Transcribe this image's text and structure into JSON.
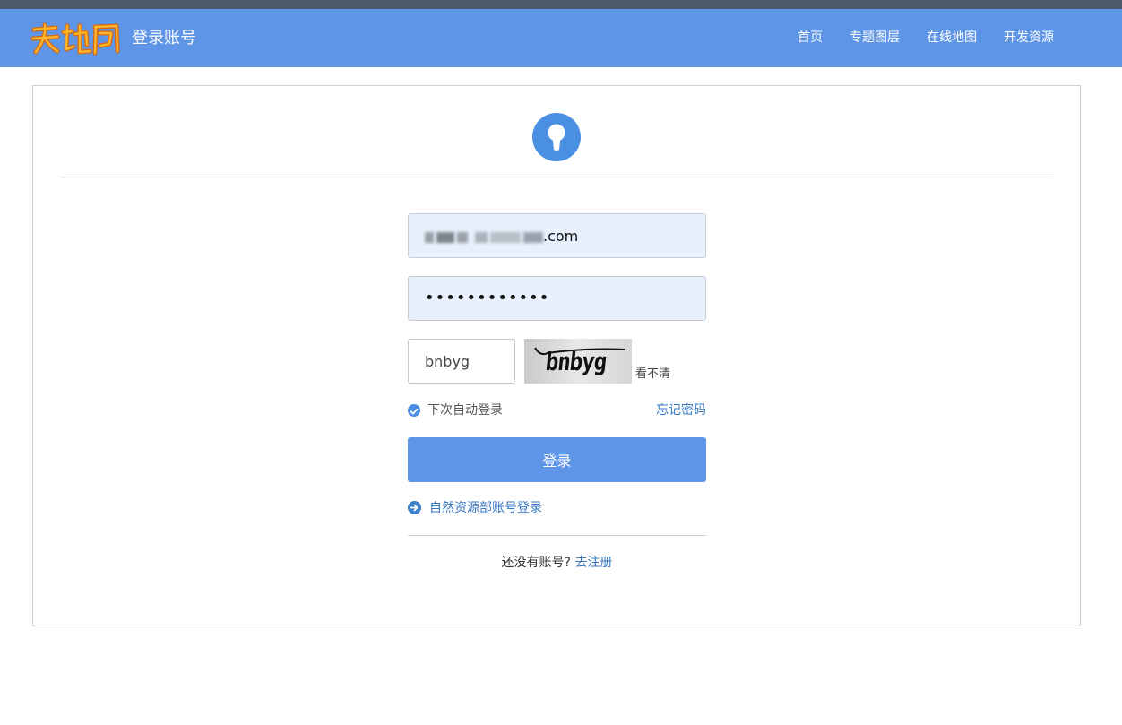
{
  "header": {
    "logo_text": "天地图",
    "title": "登录账号",
    "nav": [
      "首页",
      "专题图层",
      "在线地图",
      "开发资源"
    ]
  },
  "form": {
    "email_value_visible": ".com",
    "password_masked": "••••••••••••",
    "captcha_value": "bnbyg",
    "captcha_image_text": "bnbyg",
    "refresh_label": "看不清",
    "remember_label": "下次自动登录",
    "forgot_label": "忘记密码",
    "login_label": "登录",
    "alt_login_label": "自然资源部账号登录",
    "signup_question": "还没有账号?",
    "signup_link": "去注册"
  },
  "colors": {
    "header_bg": "#5f95e6",
    "accent": "#4a8fe2",
    "link": "#3778c2"
  },
  "icons": {
    "lock": "keyhole-icon",
    "remember": "check-circle-icon",
    "alt_login": "arrow-right-circle-icon"
  }
}
